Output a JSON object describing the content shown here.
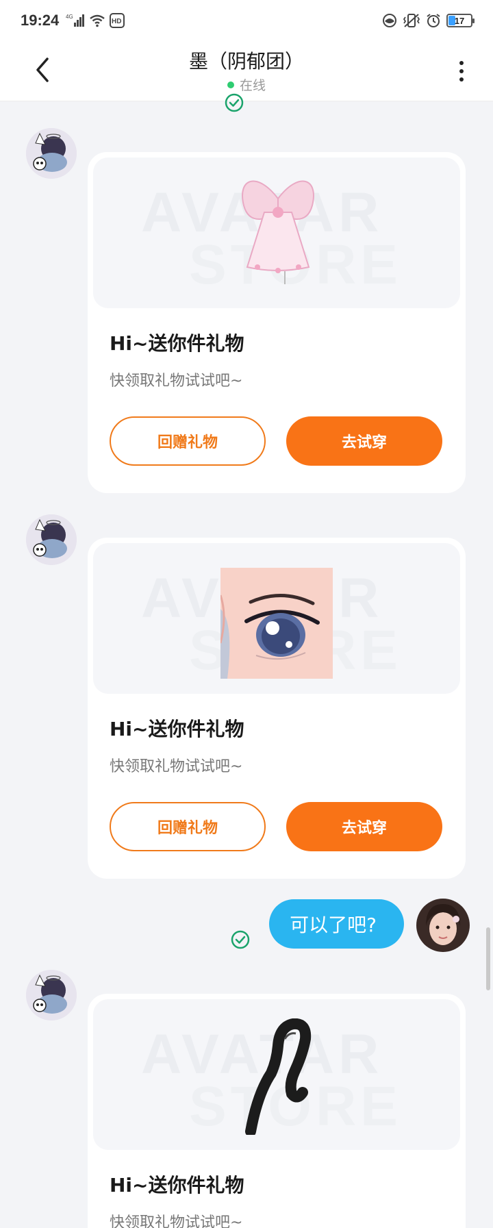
{
  "status_bar": {
    "time": "19:24",
    "network": "4G",
    "hd": "HD",
    "battery": "17"
  },
  "nav": {
    "title": "墨（阴郁团）",
    "status": "在线"
  },
  "gifts": [
    {
      "title": "Hi~送你件礼物",
      "subtitle": "快领取礼物试试吧~",
      "return_label": "回赠礼物",
      "try_label": "去试穿",
      "item": "butterfly-dress"
    },
    {
      "title": "Hi~送你件礼物",
      "subtitle": "快领取礼物试试吧~",
      "return_label": "回赠礼物",
      "try_label": "去试穿",
      "item": "anime-eye"
    },
    {
      "title": "Hi~送你件礼物",
      "subtitle": "快领取礼物试试吧~",
      "item": "black-tail"
    }
  ],
  "watermark": {
    "line1": "AVATAR",
    "line2": "STORE"
  },
  "message": {
    "text": "可以了吧?"
  },
  "colors": {
    "accent": "#f97316",
    "bubble": "#2ab5f0",
    "read": "#1aa36b",
    "online": "#2ecc71"
  }
}
